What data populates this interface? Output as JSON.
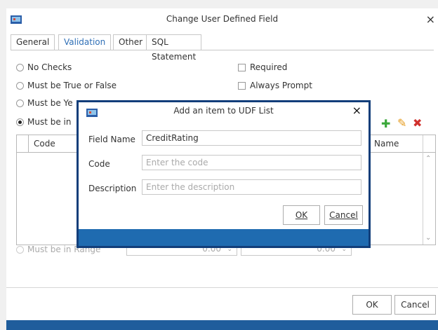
{
  "window": {
    "title": "Change User Defined Field",
    "close_label": "×"
  },
  "tabs": [
    {
      "label": "General"
    },
    {
      "label": "Validation"
    },
    {
      "label": "Other"
    },
    {
      "label": "SQL Statement"
    }
  ],
  "validation": {
    "options": [
      {
        "label": "No Checks",
        "selected": false
      },
      {
        "label": "Must be True or False",
        "selected": false
      },
      {
        "label": "Must be Ye",
        "selected": false
      },
      {
        "label": "Must be in",
        "selected": true
      }
    ],
    "checks": [
      {
        "label": "Required",
        "checked": false
      },
      {
        "label": "Always Prompt",
        "checked": false
      }
    ],
    "list_columns": [
      "Code",
      "Name"
    ],
    "range_label": "Must be in Range",
    "range_min": "0.00",
    "range_max": "0.00"
  },
  "toolbar": {
    "add_icon": "plus-icon",
    "edit_icon": "pencil-icon",
    "delete_icon": "delete-x-icon"
  },
  "footer": {
    "ok_label": "OK",
    "cancel_label": "Cancel"
  },
  "dialog": {
    "title": "Add an item to UDF List",
    "close_label": "×",
    "field_name_label": "Field Name",
    "field_name_value": "CreditRating",
    "code_label": "Code",
    "code_placeholder": "Enter the code",
    "description_label": "Description",
    "description_placeholder": "Enter the description",
    "ok_label": "OK",
    "cancel_label": "Cancel"
  },
  "colors": {
    "accent": "#2f6fb6",
    "status_bar": "#1f5d9c",
    "dialog_border": "#123e7a",
    "add_green": "#3aa83a",
    "edit_orange": "#e59a1b",
    "delete_red": "#d0312d"
  }
}
